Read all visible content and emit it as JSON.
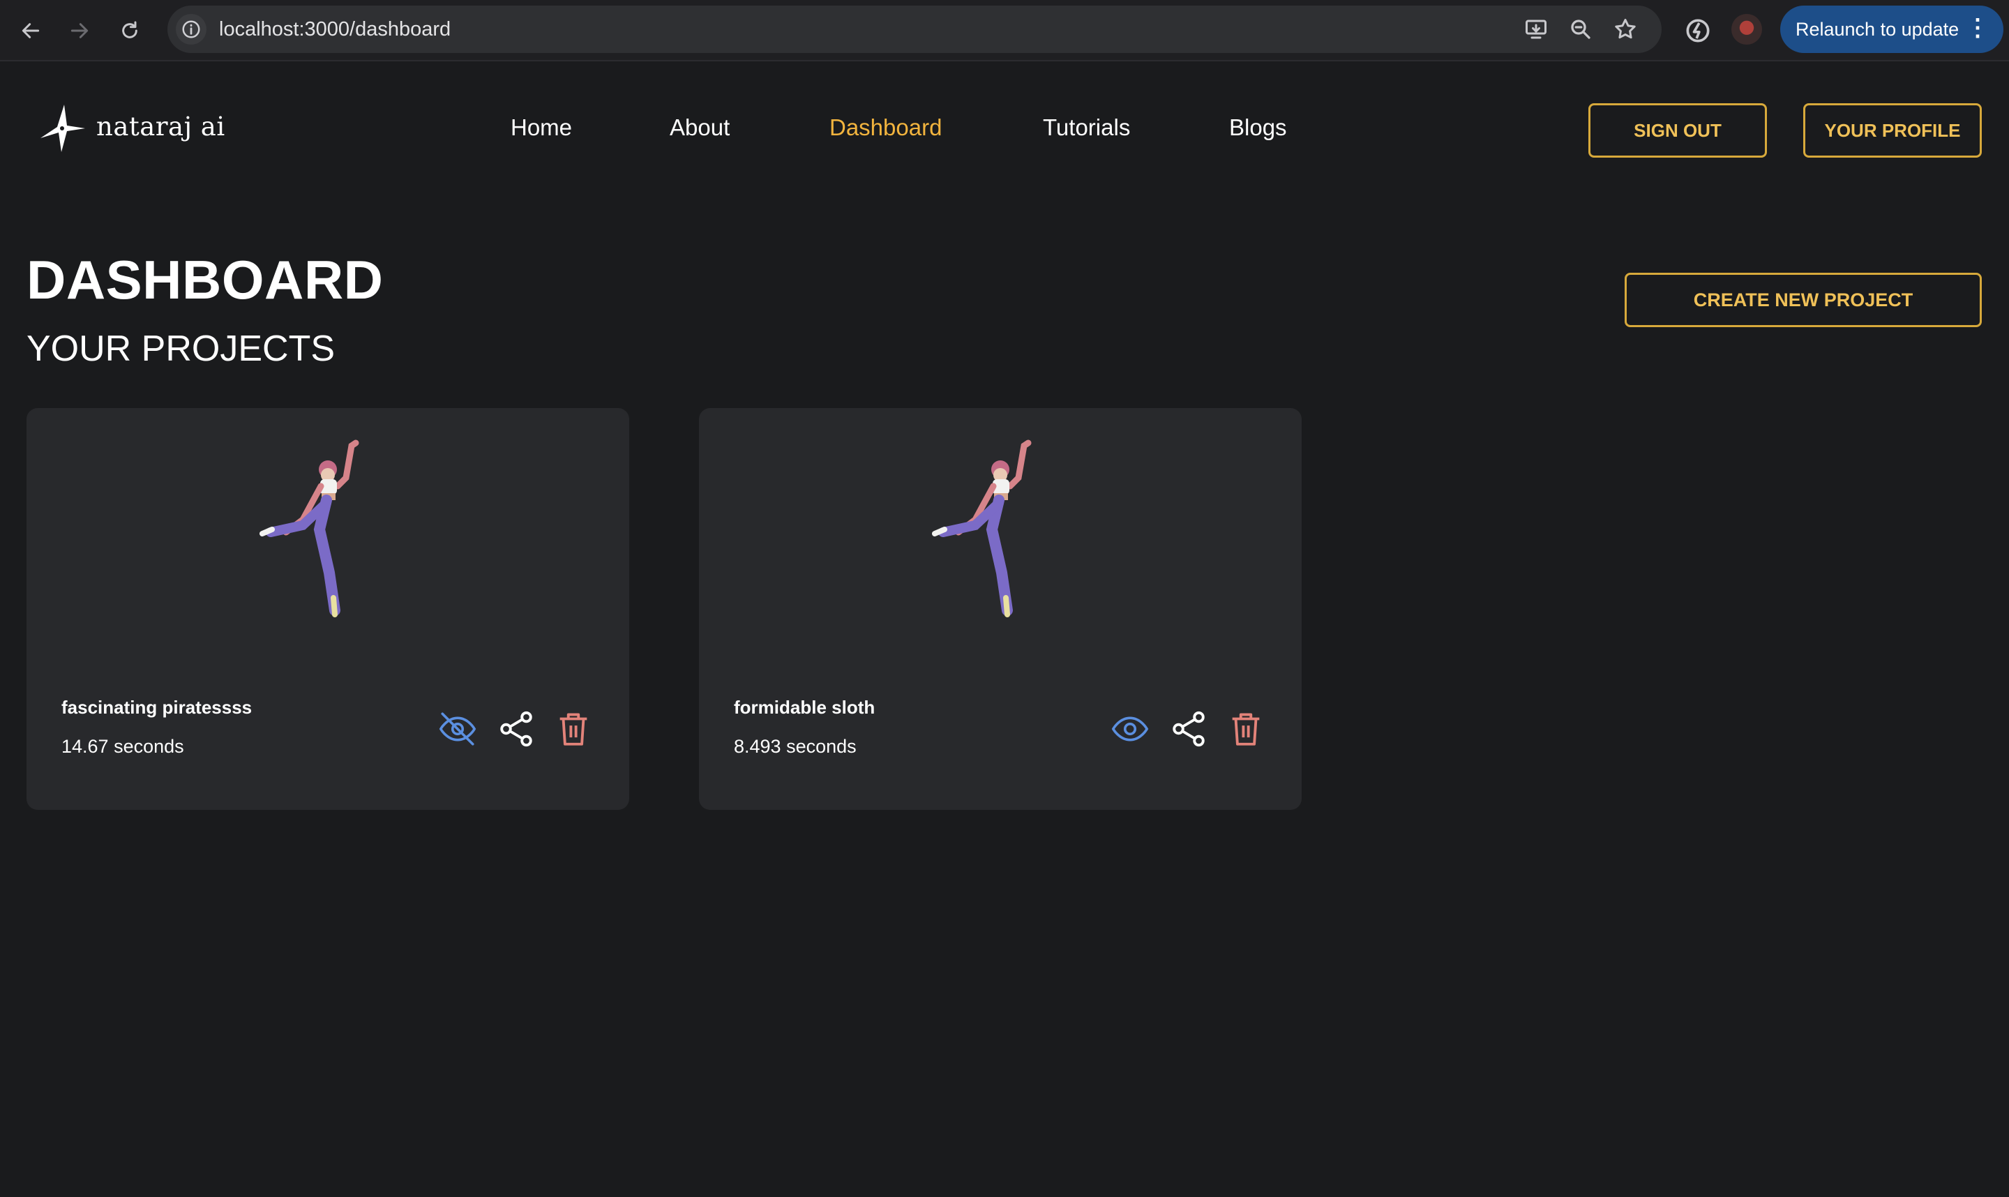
{
  "browser": {
    "url": "localhost:3000/dashboard",
    "relaunch_label": "Relaunch to update"
  },
  "header": {
    "brand": "nataraj ai",
    "nav": [
      {
        "label": "Home",
        "active": false
      },
      {
        "label": "About",
        "active": false
      },
      {
        "label": "Dashboard",
        "active": true
      },
      {
        "label": "Tutorials",
        "active": false
      },
      {
        "label": "Blogs",
        "active": false
      }
    ],
    "sign_out_label": "SIGN OUT",
    "profile_label": "YOUR PROFILE"
  },
  "page": {
    "title": "DASHBOARD",
    "subtitle": "YOUR PROJECTS",
    "create_label": "CREATE NEW PROJECT"
  },
  "projects": [
    {
      "name": "fascinating piratessss",
      "duration": "14.67 seconds",
      "visibility_icon": "eye-off-icon"
    },
    {
      "name": "formidable sloth",
      "duration": "8.493 seconds",
      "visibility_icon": "eye-icon"
    }
  ],
  "colors": {
    "accent": "#f2b43e",
    "view_icon": "#5b8fe0",
    "delete_icon": "#e3837a",
    "background": "#1a1b1d",
    "card": "#28292c"
  }
}
